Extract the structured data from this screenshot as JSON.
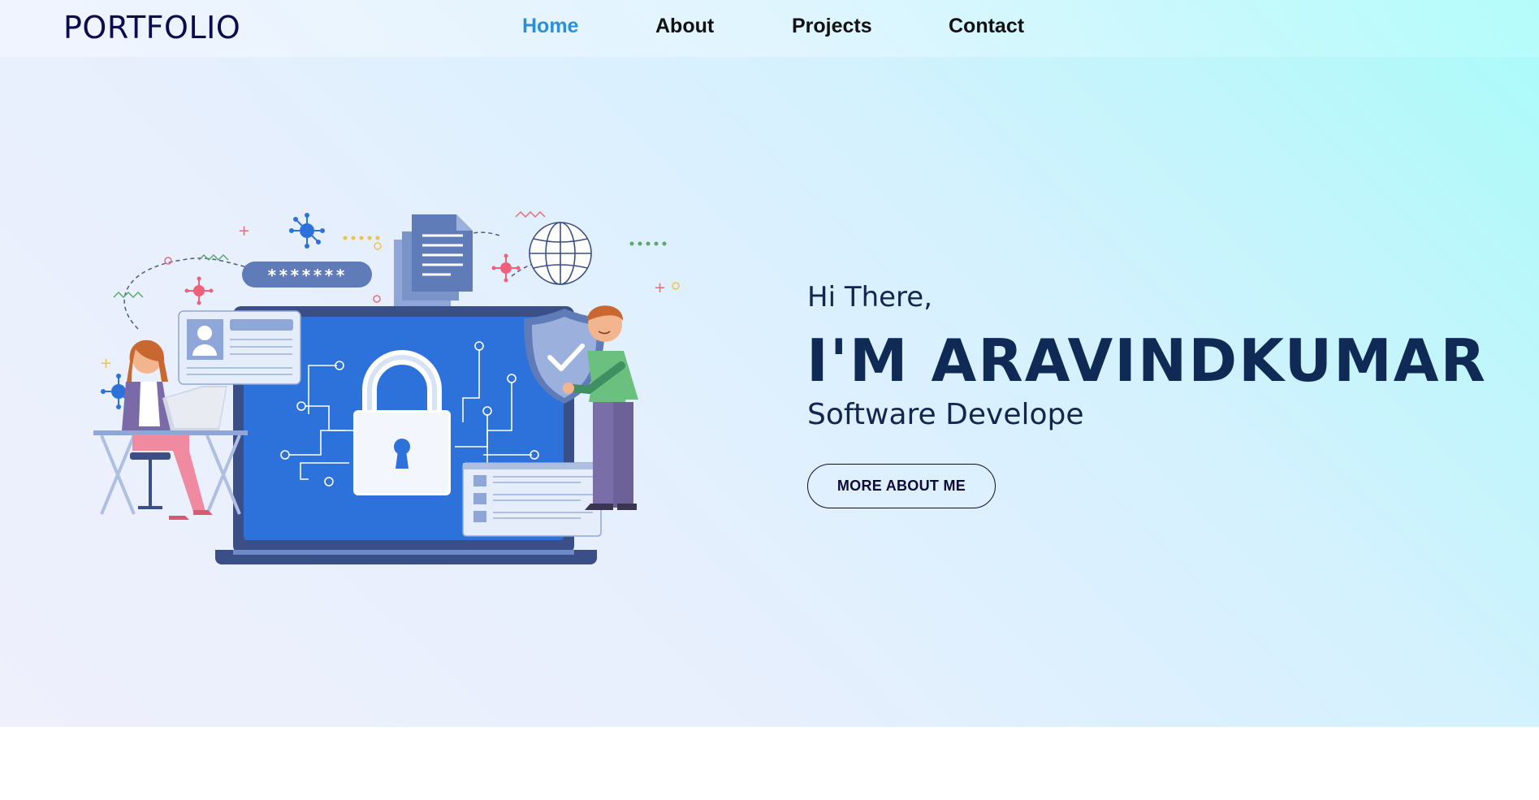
{
  "brand": {
    "logo_text": "PORTFOLIO"
  },
  "nav": {
    "items": [
      {
        "label": "Home",
        "active": true
      },
      {
        "label": "About",
        "active": false
      },
      {
        "label": "Projects",
        "active": false
      },
      {
        "label": "Contact",
        "active": false
      }
    ]
  },
  "hero": {
    "greeting": "Hi There,",
    "name": "I'M ARAVINDKUMAR",
    "role": "Software Develope",
    "cta_label": "MORE ABOUT ME",
    "illustration": {
      "password_mask": "*******"
    }
  },
  "colors": {
    "accent": "#2f8fd6",
    "heading": "#0f2a55",
    "logo": "#0d0a4e",
    "laptop_blue": "#2d72db",
    "laptop_dark": "#3a4f88"
  }
}
